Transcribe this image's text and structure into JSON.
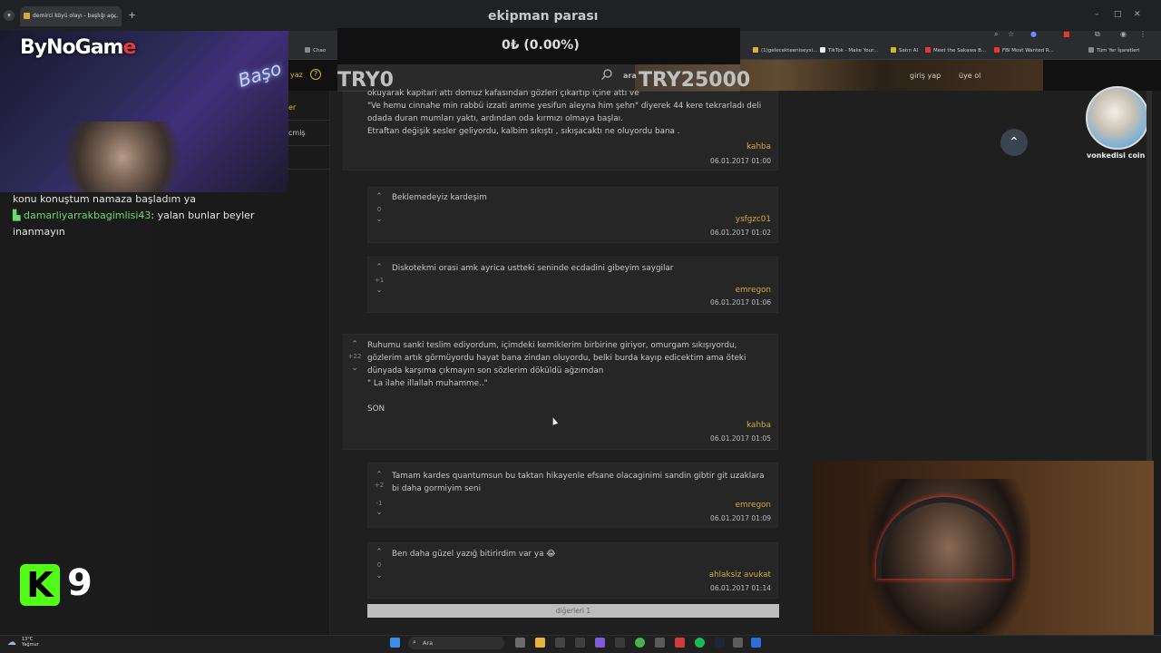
{
  "browser": {
    "tab_title": "demirci köyü olayı - başlığı aç...",
    "bookmarks": [
      {
        "label": "Chao",
        "color": "#8a8a8a"
      },
      {
        "label": "(1)gelecekteeniseysi...",
        "color": "#e0b23a"
      },
      {
        "label": "TikTok - Make Your...",
        "color": "#eeeeee"
      },
      {
        "label": "Satın Al",
        "color": "#d8b42a"
      },
      {
        "label": "Meet the Sakawa B...",
        "color": "#e53935"
      },
      {
        "label": "FBI Most Wanted R...",
        "color": "#e53935"
      },
      {
        "label": "Tüm Yer İşaretleri",
        "color": "#8a8a8a"
      }
    ]
  },
  "site": {
    "write_label": "yaz",
    "search_label": "ara",
    "login": "giriş yap",
    "register": "üye ol",
    "sidebar_items": [
      "er",
      "cmiş"
    ]
  },
  "posts": {
    "first_post": {
      "lines": [
        "okuyarak kapitari attı domuz kafasından gözleri çıkartıp içine attı ve",
        "\"Ve hemu cinnahe min rabbü izzati amme yesifun aleyna him şehn\" diyerek 44 kere tekrarladı deli",
        "odada duran mumları yaktı, ardından oda kırmızı olmaya başlaı.",
        "Etraftan değişik sesler geliyordu, kalbim sıkıştı , sıkışacaktı ne oluyordu bana ."
      ],
      "author": "kahba",
      "date": "06.01.2017 01:00"
    },
    "reply1": {
      "text": "Beklemedeyiz kardeşim",
      "score": "0",
      "author": "ysfgzc01",
      "date": "06.01.2017 01:02"
    },
    "reply2": {
      "text": "Diskotekmi orasi amk ayrica ustteki seninde ecdadini gibeyim saygilar",
      "score": "+1",
      "author": "emregon",
      "date": "06.01.2017 01:06"
    },
    "main_post": {
      "lines": [
        "Ruhumu sanki teslim ediyordum, içimdeki kemiklerim birbirine giriyor, omurgam sıkışıyordu,",
        "gözlerim artık görmüyordu hayat bana zindan oluyordu, belki burda kayıp edicektim ama öteki",
        "dünyada karşıma çıkmayın son sözlerim döküldü ağzımdan",
        "\" La ilahe illallah muhamme..\"",
        "",
        "SON"
      ],
      "score": "+22",
      "author": "kahba",
      "date": "06.01.2017 01:05"
    },
    "reply3": {
      "lines": [
        "Tamam kardes quantumsun bu taktan hikayenle efsane olacaginimi sandin gibtir git uzaklara",
        "bi daha gormiyim seni"
      ],
      "score_up": "+2",
      "score_down": "-1",
      "author": "emregon",
      "date": "06.01.2017 01:09"
    },
    "reply4": {
      "text": "Ben daha güzel yazığ bitirirdim var ya 😂",
      "score": "0",
      "author": "ahlaksiz avukat",
      "date": "06.01.2017 01:14"
    },
    "more_label": "diğerleri 1"
  },
  "right": {
    "avatar_name": "vonkedisi coin"
  },
  "stream": {
    "logo_main": "ByNoGam",
    "logo_end": "e",
    "neon": "Başo",
    "donation_title": "ekipman parası",
    "goal_text": "0₺ (0.00%)",
    "goal_start": "TRY0",
    "goal_end": "TRY25000",
    "chat": {
      "line1": "konu konuştum namaza başladım ya",
      "user": "damarliyarrakbagimlisi43",
      "message": ": yalan bunlar beyler inanmayın"
    },
    "kick_badge": "K",
    "kick_count": "9"
  },
  "taskbar": {
    "temp": "13°C",
    "weather": "Yağmur",
    "search": "Ara"
  }
}
